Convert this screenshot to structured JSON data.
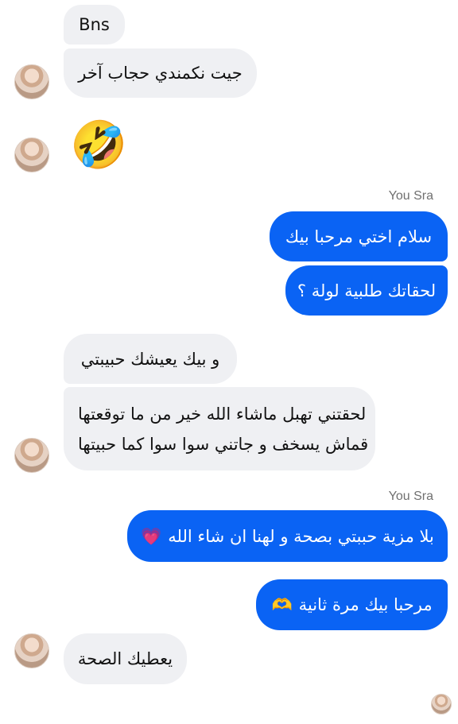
{
  "messages": {
    "m1": "Bns",
    "m2": "جيت نكمندي حجاب آخر",
    "m3_emoji": "🤣",
    "sender_label_1": "You Sra",
    "m4": "سلام اختي مرحبا بيك",
    "m5": "لحقاتك طلبية لولة ؟",
    "m6": "و بيك يعيشك حبيبتي",
    "m7_line1": "لحقتني تهبل ماشاء الله خير من ما توقعتها",
    "m7_line2": "قماش يسخف و جاتني سوا سوا كما حبيتها",
    "sender_label_2": "You Sra",
    "m8": "بلا مزية حببتي بصحة و لهنا ان شاء الله",
    "m8_emoji": "💗",
    "m9": "مرحبا بيك مرة ثانية",
    "m9_emoji": "🫶",
    "m10": "يعطيك الصحة"
  },
  "colors": {
    "outgoing_bubble": "#0a63f4",
    "incoming_bubble": "#eff0f3"
  }
}
